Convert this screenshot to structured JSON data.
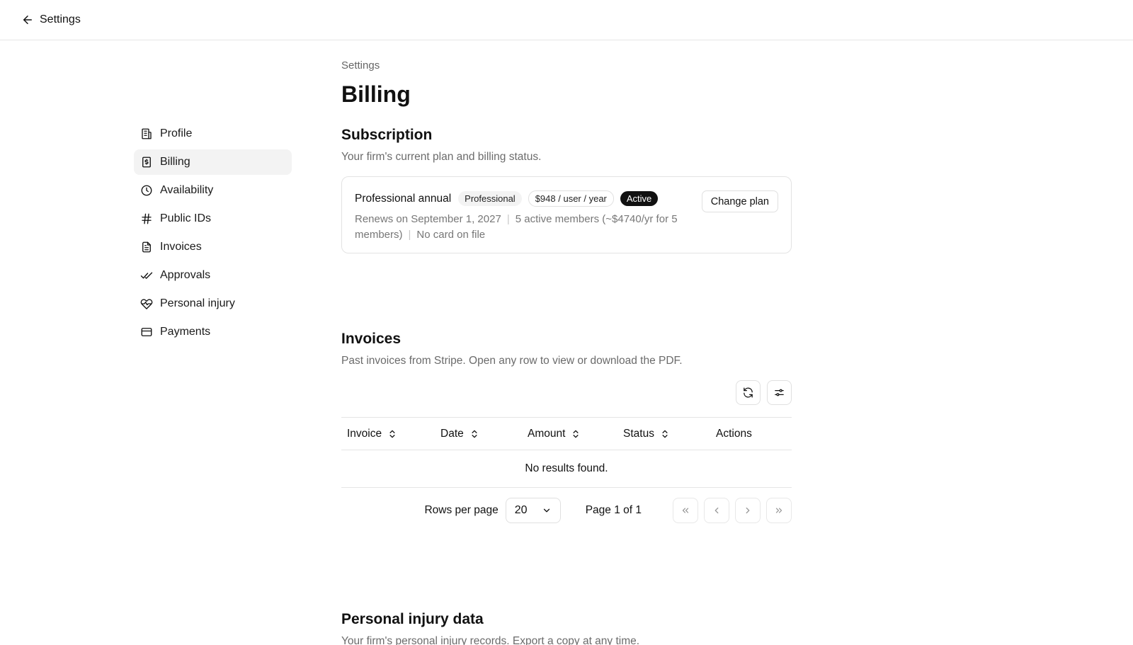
{
  "topbar": {
    "back_label": "Settings"
  },
  "sidebar": {
    "items": [
      {
        "label": "Profile",
        "icon": "building-icon"
      },
      {
        "label": "Billing",
        "icon": "receipt-dollar-icon",
        "active": true
      },
      {
        "label": "Availability",
        "icon": "clock-icon"
      },
      {
        "label": "Public IDs",
        "icon": "hash-icon"
      },
      {
        "label": "Invoices",
        "icon": "document-icon"
      },
      {
        "label": "Approvals",
        "icon": "double-check-icon"
      },
      {
        "label": "Personal injury",
        "icon": "heart-pulse-icon"
      },
      {
        "label": "Payments",
        "icon": "credit-card-icon"
      }
    ]
  },
  "main": {
    "breadcrumb": "Settings",
    "title": "Billing",
    "subscription": {
      "title": "Subscription",
      "description": "Your firm's current plan and billing status.",
      "plan_name": "Professional annual",
      "tier_badge": "Professional",
      "price_badge": "$948 / user / year",
      "status_badge": "Active",
      "renews": "Renews on September 1, 2027",
      "members": "5 active members (~$4740/yr for 5 members)",
      "card": "No card on file",
      "change_button": "Change plan"
    },
    "invoices": {
      "title": "Invoices",
      "description": "Past invoices from Stripe. Open any row to view or download the PDF.",
      "columns": [
        "Invoice",
        "Date",
        "Amount",
        "Status",
        "Actions"
      ],
      "empty_text": "No results found.",
      "rows_per_page_label": "Rows per page",
      "rows_per_page_value": "20",
      "page_label": "Page 1 of 1"
    },
    "personal_injury": {
      "title": "Personal injury data",
      "description": "Your firm's personal injury records. Export a copy at any time."
    }
  },
  "colors": {
    "text": "#111111",
    "muted": "#6b6b6b",
    "border": "#e5e5e5",
    "active_bg": "#f3f3f3",
    "badge_dark": "#111111"
  }
}
